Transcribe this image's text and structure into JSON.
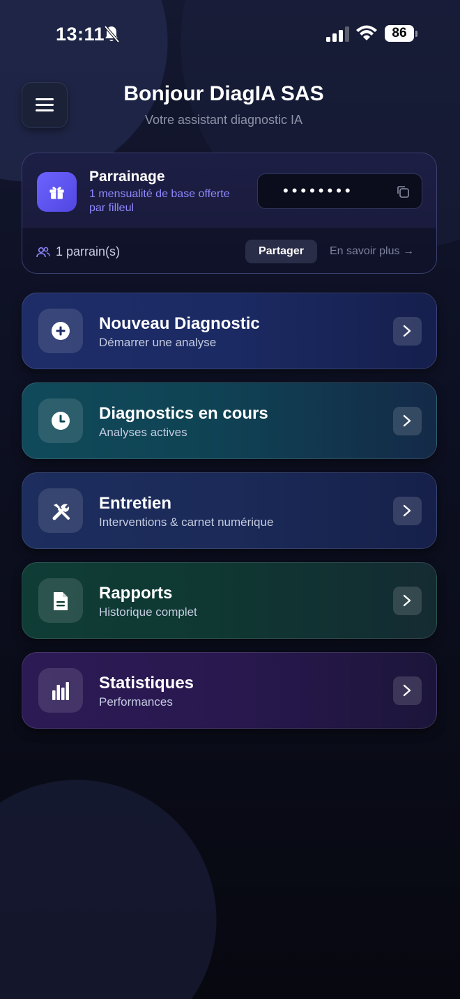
{
  "status_bar": {
    "time": "13:11",
    "battery": "86"
  },
  "header": {
    "greeting": "Bonjour DiagIA SAS",
    "subtitle": "Votre assistant diagnostic IA"
  },
  "referral": {
    "title": "Parrainage",
    "description": "1 mensualité de base offerte par filleul",
    "code_masked": "••••••••",
    "count_text": "1 parrain(s)",
    "share_label": "Partager",
    "learn_more_label": "En savoir plus →"
  },
  "actions": [
    {
      "title": "Nouveau Diagnostic",
      "subtitle": "Démarrer une analyse",
      "icon": "plus-circle-icon"
    },
    {
      "title": "Diagnostics en cours",
      "subtitle": "Analyses actives",
      "icon": "clock-icon"
    },
    {
      "title": "Entretien",
      "subtitle": "Interventions & carnet numérique",
      "icon": "tools-icon"
    },
    {
      "title": "Rapports",
      "subtitle": "Historique complet",
      "icon": "document-icon"
    },
    {
      "title": "Statistiques",
      "subtitle": "Performances",
      "icon": "bar-chart-icon"
    }
  ],
  "colors": {
    "accent": "#6c63ff",
    "accent_text": "#8f89ff",
    "background": "#0a0c16"
  }
}
